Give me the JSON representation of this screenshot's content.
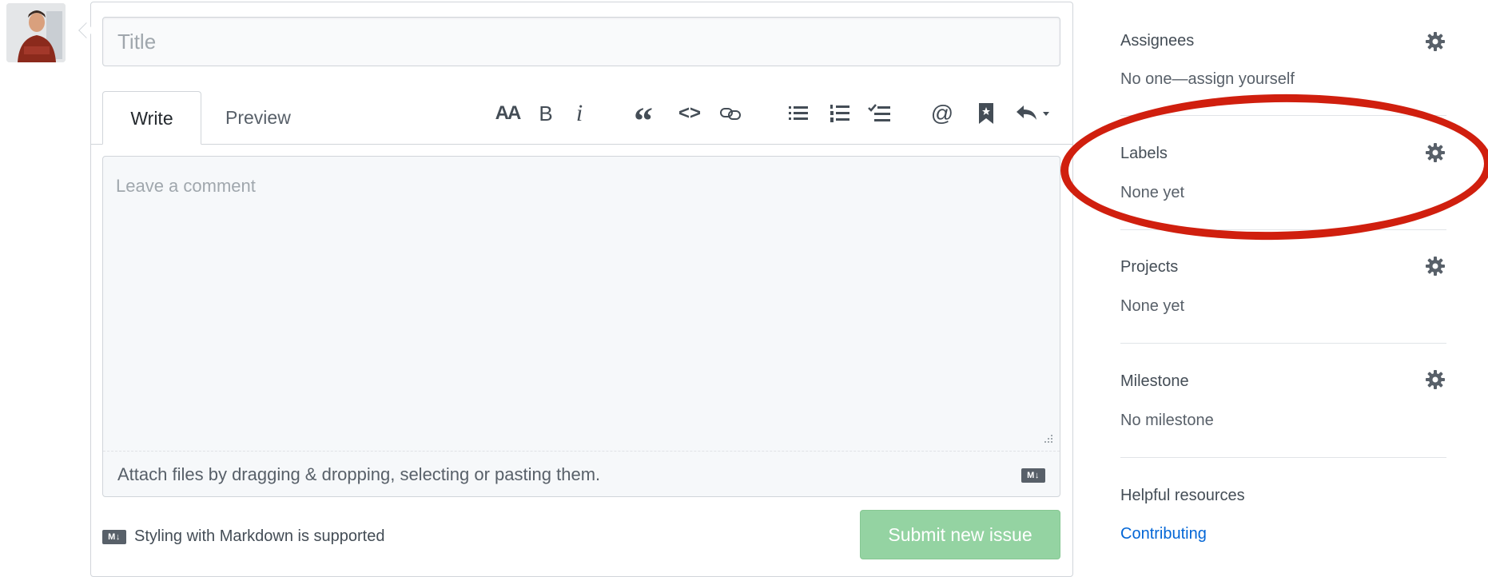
{
  "title_field": {
    "placeholder": "Title",
    "value": ""
  },
  "tabs": [
    {
      "label": "Write",
      "active": true
    },
    {
      "label": "Preview",
      "active": false
    }
  ],
  "toolbar": {
    "icons": [
      "text-size-icon",
      "bold-icon",
      "italic-icon",
      "quote-icon",
      "code-icon",
      "link-icon",
      "unordered-list-icon",
      "ordered-list-icon",
      "task-list-icon",
      "mention-icon",
      "bookmark-icon",
      "reply-icon"
    ],
    "heading_label": "AA",
    "bold_label": "B",
    "italic_label": "i",
    "quote_label": "“",
    "code_label": "<>",
    "mention_label": "@"
  },
  "comment": {
    "placeholder": "Leave a comment",
    "attach_text": "Attach files by dragging & dropping, selecting or pasting them.",
    "markdown_badge": "M↓"
  },
  "markdown_note": "Styling with Markdown is supported",
  "submit_button": "Submit new issue",
  "sidebar": {
    "assignees": {
      "heading": "Assignees",
      "value": "No one—assign yourself"
    },
    "labels": {
      "heading": "Labels",
      "value": "None yet"
    },
    "projects": {
      "heading": "Projects",
      "value": "None yet"
    },
    "milestone": {
      "heading": "Milestone",
      "value": "No milestone"
    },
    "helpful": {
      "heading": "Helpful resources",
      "link": "Contributing"
    }
  },
  "colors": {
    "submit_disabled": "#94d3a2",
    "link": "#0366d6",
    "highlight": "#d01f0e",
    "border": "#d1d5da"
  }
}
